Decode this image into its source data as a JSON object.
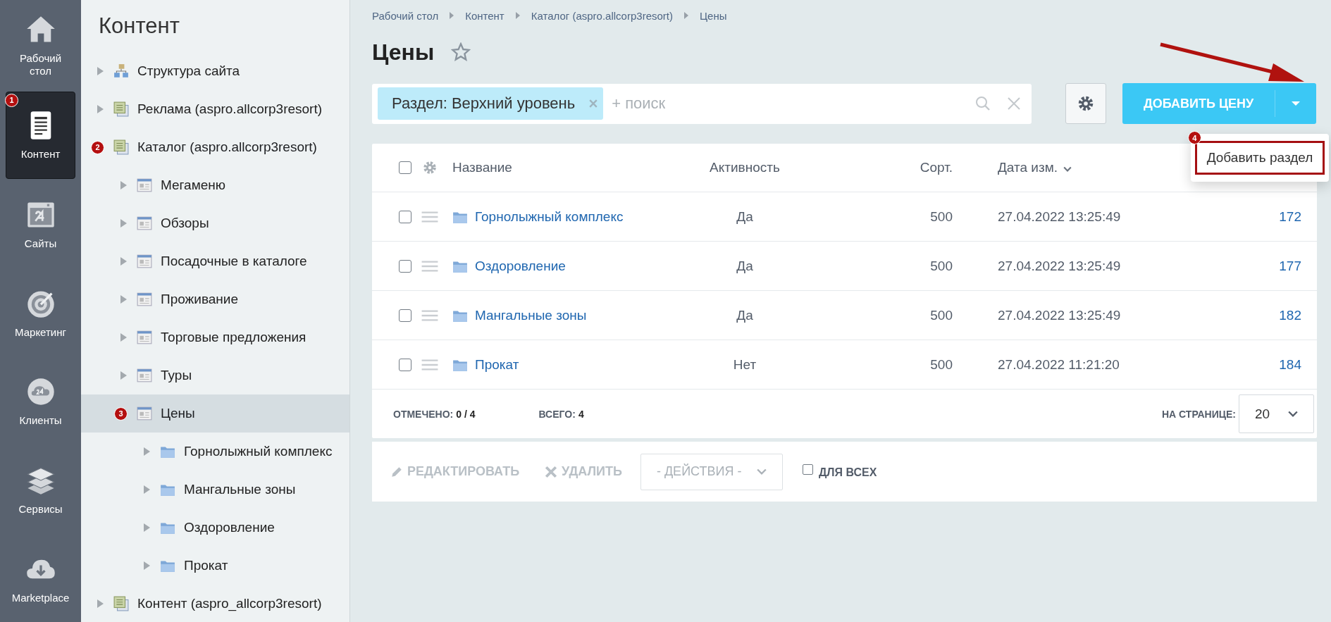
{
  "nav": [
    {
      "label": "Рабочий стол",
      "selected": false
    },
    {
      "label": "Контент",
      "selected": true,
      "annotation": "1"
    },
    {
      "label": "Сайты",
      "selected": false
    },
    {
      "label": "Маркетинг",
      "selected": false
    },
    {
      "label": "Клиенты",
      "selected": false
    },
    {
      "label": "Сервисы",
      "selected": false
    },
    {
      "label": "Marketplace",
      "selected": false
    }
  ],
  "tree": {
    "title": "Контент",
    "items": [
      {
        "label": "Структура сайта",
        "kind": "structure",
        "expanded": false,
        "selected": false
      },
      {
        "label": "Реклама (aspro.allcorp3resort)",
        "kind": "iblock-type",
        "expanded": false,
        "selected": false
      },
      {
        "label": "Каталог (aspro.allcorp3resort)",
        "kind": "iblock-type",
        "expanded": true,
        "selected": false,
        "annotation": "2",
        "children": [
          {
            "label": "Мегаменю",
            "kind": "iblock",
            "expanded": false,
            "selected": false
          },
          {
            "label": "Обзоры",
            "kind": "iblock",
            "expanded": false,
            "selected": false
          },
          {
            "label": "Посадочные в каталоге",
            "kind": "iblock",
            "expanded": false,
            "selected": false
          },
          {
            "label": "Проживание",
            "kind": "iblock",
            "expanded": false,
            "selected": false
          },
          {
            "label": "Торговые предложения",
            "kind": "iblock",
            "expanded": false,
            "selected": false
          },
          {
            "label": "Туры",
            "kind": "iblock",
            "expanded": false,
            "selected": false
          },
          {
            "label": "Цены",
            "kind": "iblock",
            "expanded": true,
            "selected": true,
            "annotation": "3",
            "children": [
              {
                "label": "Горнолыжный комплекс",
                "kind": "folder",
                "expanded": false,
                "selected": false
              },
              {
                "label": "Мангальные зоны",
                "kind": "folder",
                "expanded": false,
                "selected": false
              },
              {
                "label": "Оздоровление",
                "kind": "folder",
                "expanded": false,
                "selected": false
              },
              {
                "label": "Прокат",
                "kind": "folder",
                "expanded": false,
                "selected": false
              }
            ]
          }
        ]
      },
      {
        "label": "Контент (aspro_allcorp3resort)",
        "kind": "iblock-type",
        "expanded": false,
        "selected": false
      }
    ]
  },
  "breadcrumbs": [
    "Рабочий стол",
    "Контент",
    "Каталог (aspro.allcorp3resort)",
    "Цены"
  ],
  "page_title": "Цены",
  "filter": {
    "tag": "Раздел: Верхний уровень",
    "placeholder": "+ поиск"
  },
  "add_button": {
    "label": "ДОБАВИТЬ ЦЕНУ"
  },
  "add_menu": {
    "items": [
      {
        "label": "Добавить раздел",
        "annotation": "4"
      }
    ]
  },
  "table": {
    "select_all_checked": false,
    "columns": [
      "Название",
      "Активность",
      "Сорт.",
      "Дата изм."
    ],
    "rows": [
      {
        "checked": false,
        "name": "Горнолыжный комплекс",
        "active": "Да",
        "sort": "500",
        "date": "27.04.2022 13:25:49",
        "id": "172"
      },
      {
        "checked": false,
        "name": "Оздоровление",
        "active": "Да",
        "sort": "500",
        "date": "27.04.2022 13:25:49",
        "id": "177"
      },
      {
        "checked": false,
        "name": "Мангальные зоны",
        "active": "Да",
        "sort": "500",
        "date": "27.04.2022 13:25:49",
        "id": "182"
      },
      {
        "checked": false,
        "name": "Прокат",
        "active": "Нет",
        "sort": "500",
        "date": "27.04.2022 11:21:20",
        "id": "184"
      }
    ],
    "footer": {
      "selected_label": "ОТМЕЧЕНО:",
      "selected_value": "0 / 4",
      "total_label": "ВСЕГО:",
      "total_value": "4",
      "page_size_label": "НА СТРАНИЦЕ:",
      "page_size": "20"
    }
  },
  "actions": {
    "edit": {
      "label": "РЕДАКТИРОВАТЬ",
      "disabled": true
    },
    "delete": {
      "label": "УДАЛИТЬ",
      "disabled": true
    },
    "select": "- ДЕЙСТВИЯ -",
    "for_all": {
      "label": "ДЛЯ ВСЕХ",
      "checked": false
    }
  }
}
